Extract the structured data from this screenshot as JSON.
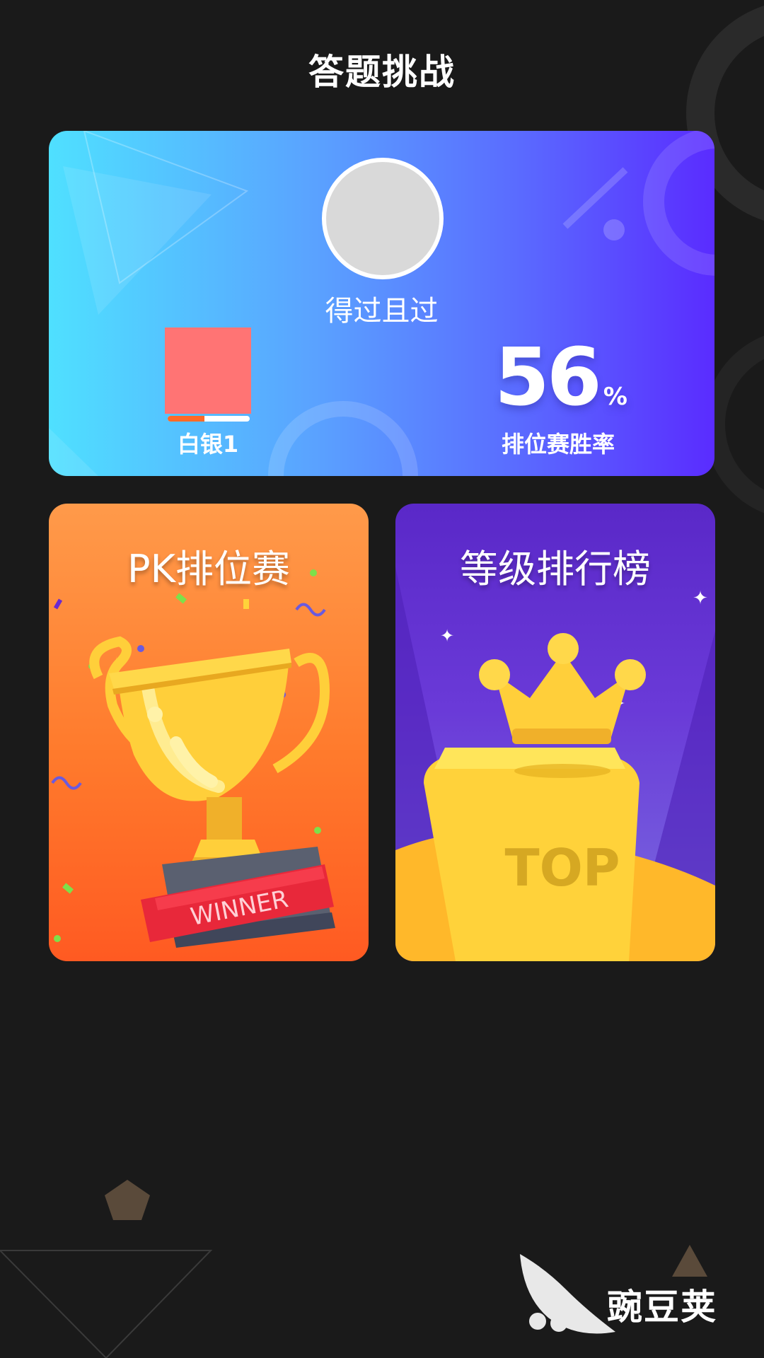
{
  "header": {
    "title": "答题挑战"
  },
  "profile": {
    "nickname": "得过且过",
    "rank_name": "白银1",
    "rank_progress": 0.45,
    "win_rate_value": "56",
    "win_rate_unit": "%",
    "win_rate_label": "排位赛胜率"
  },
  "cards": {
    "pk": {
      "title": "PK排位赛",
      "banner_text": "WINNER"
    },
    "leaderboard": {
      "title": "等级排行榜",
      "podium_text": "TOP"
    }
  },
  "watermark": {
    "text": "豌豆荚"
  },
  "colors": {
    "background": "#1a1a1a",
    "rank_badge": "#ff7474",
    "progress_fill": "#ff6a28"
  },
  "icons": [
    "trophy-icon",
    "crown-icon",
    "watermark-logo-icon"
  ]
}
